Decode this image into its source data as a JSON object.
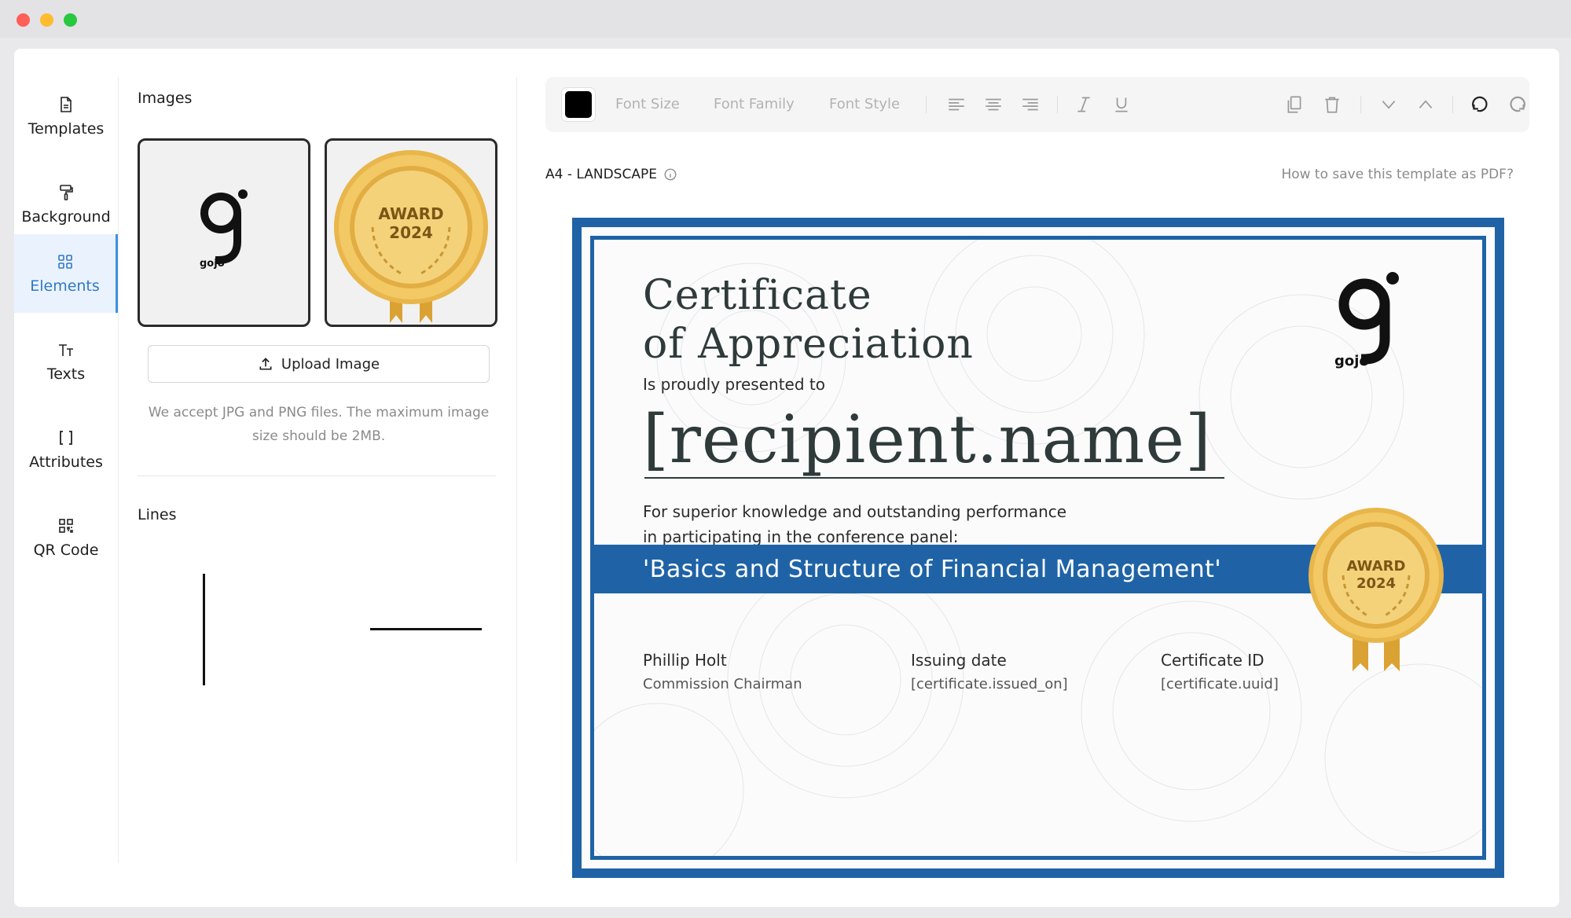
{
  "window": {
    "controls": [
      "close",
      "minimize",
      "zoom"
    ]
  },
  "nav": {
    "items": [
      {
        "label": "Templates",
        "icon": "file-icon",
        "active": false
      },
      {
        "label": "Background",
        "icon": "paint-roller-icon",
        "active": false
      },
      {
        "label": "Elements",
        "icon": "grid-icon",
        "active": true
      },
      {
        "label": "Texts",
        "icon": "text-size-icon",
        "active": false
      },
      {
        "label": "Attributes",
        "icon": "brackets-icon",
        "active": false
      },
      {
        "label": "QR Code",
        "icon": "qr-code-icon",
        "active": false
      }
    ]
  },
  "panel": {
    "images_title": "Images",
    "images": [
      {
        "name": "gojo-logo",
        "logo_text": "gojo"
      },
      {
        "name": "award-badge",
        "line1": "AWARD",
        "line2": "2024"
      }
    ],
    "upload_label": "Upload Image",
    "upload_note": "We accept JPG and PNG files. The maximum image size should be 2MB.",
    "lines_title": "Lines"
  },
  "toolbar": {
    "color": "#000000",
    "font_size": "Font Size",
    "font_family": "Font Family",
    "font_style": "Font Style",
    "icons": [
      "align-left-icon",
      "align-center-icon",
      "align-right-icon",
      "italic-icon",
      "underline-icon",
      "duplicate-icon",
      "trash-icon",
      "move-down-icon",
      "move-up-icon",
      "undo-icon",
      "redo-icon"
    ]
  },
  "canvas": {
    "page_size": "A4 - LANDSCAPE",
    "help_link": "How to save this template as PDF?"
  },
  "certificate": {
    "title_line1": "Certificate",
    "title_line2": "of Appreciation",
    "presented": "Is proudly presented to",
    "recipient": "[recipient.name]",
    "body_line1": "For superior knowledge and outstanding performance",
    "body_line2": "in participating in the conference panel:",
    "banner": "'Basics and Structure of Financial Management'",
    "logo_text": "gojo",
    "badge_line1": "AWARD",
    "badge_line2": "2024",
    "signatures": [
      {
        "name": "Phillip Holt",
        "sub": "Commission Chairman"
      },
      {
        "name": "Issuing date",
        "sub": "[certificate.issued_on]"
      },
      {
        "name": "Certificate ID",
        "sub": "[certificate.uuid]"
      }
    ]
  },
  "colors": {
    "accent": "#1f63a6",
    "nav_active": "#3178c6",
    "gold": "#e0a93a"
  }
}
